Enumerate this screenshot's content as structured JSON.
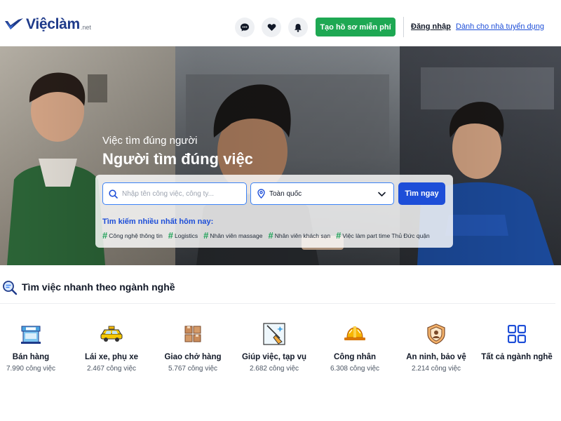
{
  "header": {
    "logo_text": "Việclàm",
    "logo_suffix": ".net",
    "icons": [
      "chat-icon",
      "heart-icon",
      "bell-icon"
    ],
    "cta_label": "Tạo hồ sơ miễn phí",
    "login_label": "Đăng nhập",
    "employer_label": "Dành cho nhà tuyển dụng"
  },
  "hero": {
    "subtitle": "Việc tìm đúng người",
    "title": "Người tìm đúng việc",
    "search": {
      "placeholder": "Nhập tên công việc, công ty...",
      "location_value": "Toàn quốc",
      "button_label": "Tìm ngay"
    },
    "trending_label": "Tìm kiếm nhiều nhất hôm nay:",
    "trending_tags": [
      "Công nghệ thông tin",
      "Logistics",
      "Nhân viên massage",
      "Nhân viên khách sạn",
      "Việc làm part time Thủ Đức quận"
    ]
  },
  "categories_section": {
    "title": "Tìm việc nhanh theo ngành nghề",
    "items": [
      {
        "name": "Bán hàng",
        "count": "7.990 công việc",
        "icon": "shop-icon"
      },
      {
        "name": "Lái xe, phụ xe",
        "count": "2.467 công việc",
        "icon": "taxi-icon"
      },
      {
        "name": "Giao chở hàng",
        "count": "5.767 công việc",
        "icon": "boxes-icon"
      },
      {
        "name": "Giúp việc, tạp vụ",
        "count": "2.682 công việc",
        "icon": "cleaning-icon"
      },
      {
        "name": "Công nhân",
        "count": "6.308 công việc",
        "icon": "hardhat-icon"
      },
      {
        "name": "An ninh, bảo vệ",
        "count": "2.214 công việc",
        "icon": "security-badge-icon"
      },
      {
        "name": "Tất cả ngành nghề",
        "count": "",
        "icon": "grid-icon"
      }
    ]
  },
  "colors": {
    "brand_blue": "#1e3a8a",
    "primary_blue": "#1d4ed8",
    "green": "#1ea853"
  }
}
